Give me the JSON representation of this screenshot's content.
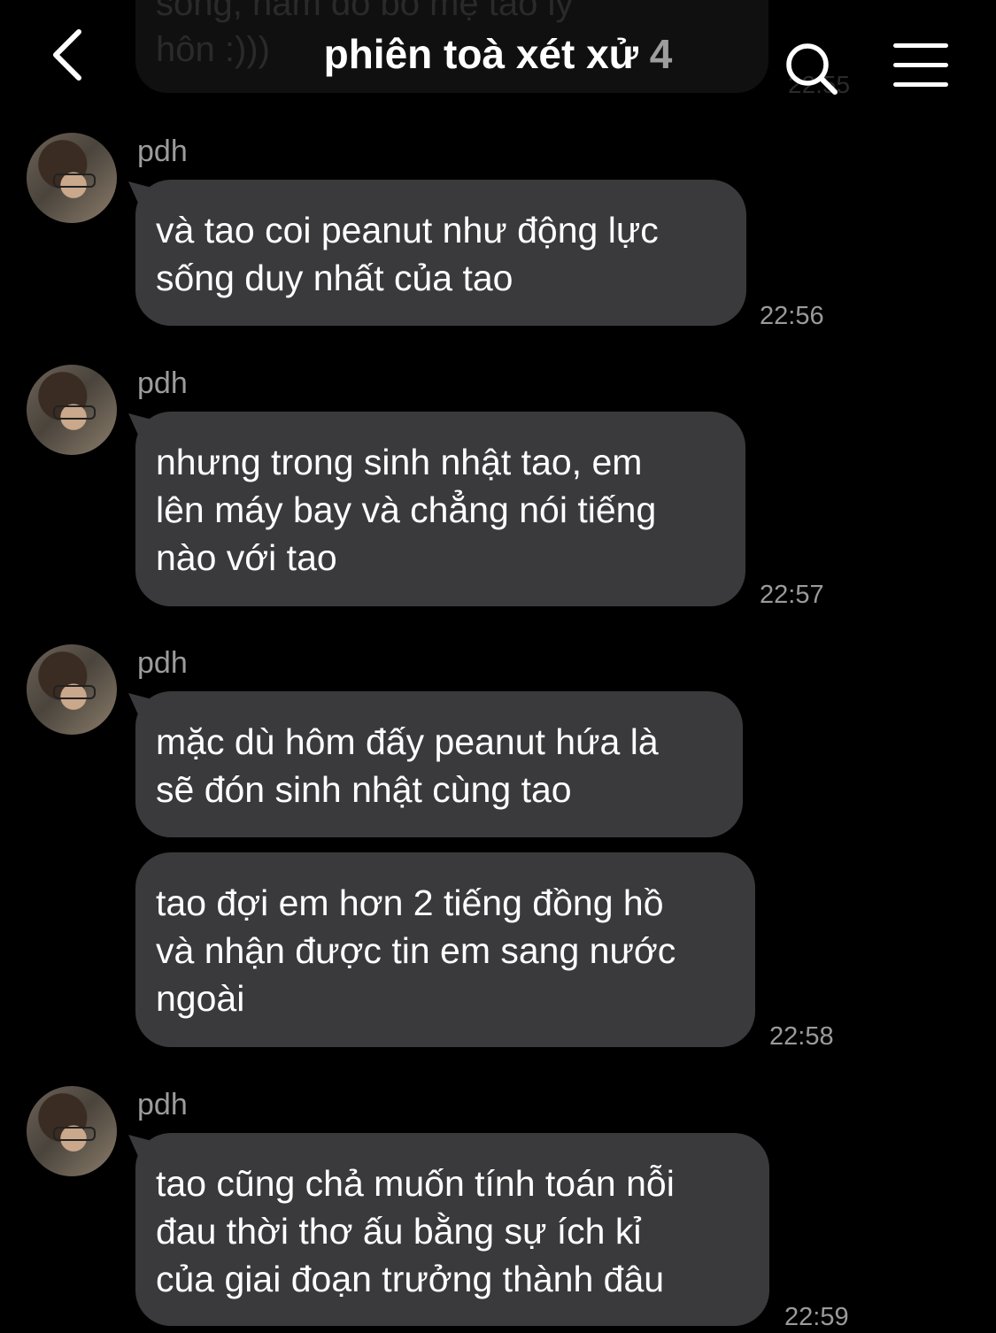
{
  "header": {
    "back_icon": "chevron-left-icon",
    "title": "phiên toà xét xử",
    "member_count": "4",
    "search_icon": "search-icon",
    "menu_icon": "hamburger-menu-icon"
  },
  "previous_message": {
    "text": "sống, năm đó bố mẹ tao ly\nhôn :)))",
    "time": "22:55"
  },
  "messages": [
    {
      "sender": "pdh",
      "text": "và tao coi peanut như động lực\nsống duy nhất của tao",
      "time": "22:56"
    },
    {
      "sender": "pdh",
      "text": "nhưng trong sinh nhật tao, em\nlên máy bay và chẳng nói tiếng\nnào với tao",
      "time": "22:57"
    },
    {
      "sender": "pdh",
      "text": "mặc dù hôm đấy peanut hứa là\nsẽ đón sinh nhật cùng tao",
      "text2": "tao đợi em hơn 2 tiếng đồng hồ\nvà nhận được tin em sang nước\nngoài",
      "time": "22:58"
    },
    {
      "sender": "pdh",
      "text": "tao cũng chả muốn tính toán nỗi\nđau thời thơ ấu bằng sự ích kỉ\ncủa giai đoạn trưởng thành đâu",
      "time": "22:59"
    }
  ],
  "colors": {
    "background": "#000000",
    "bubble": "#3a3a3c",
    "secondary_text": "#9a9a9a"
  }
}
